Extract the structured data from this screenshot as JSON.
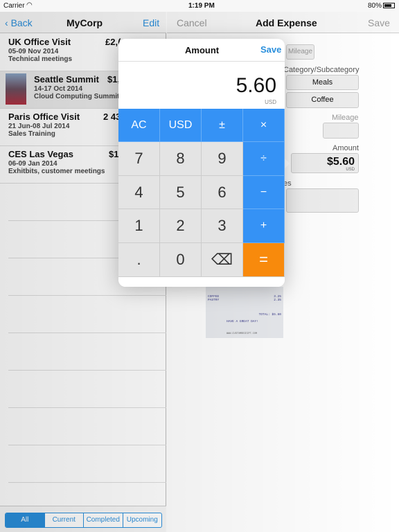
{
  "status": {
    "carrier": "Carrier",
    "time": "1:19 PM",
    "battery": "80%"
  },
  "left": {
    "back": "Back",
    "title": "MyCorp",
    "edit": "Edit",
    "trips": [
      {
        "title": "UK Office Visit",
        "dates": "05-09 Nov 2014",
        "desc": "Technical meetings",
        "amount": "£2,("
      },
      {
        "title": "Seattle Summit",
        "dates": "14-17 Oct 2014",
        "desc": "Cloud Computing Summit",
        "amount": "$1,"
      },
      {
        "title": "Paris Office Visit",
        "dates": "21 Jun-08 Jul 2014",
        "desc": "Sales Training",
        "amount": "2 43"
      },
      {
        "title": "CES Las Vegas",
        "dates": "06-09 Jan 2014",
        "desc": "Exhitbits, customer meetings",
        "amount": "$1"
      }
    ],
    "filters": [
      "All",
      "Current",
      "Completed",
      "Upcoming"
    ],
    "selected_filter": "All"
  },
  "right": {
    "cancel": "Cancel",
    "title": "Add Expense",
    "save": "Save",
    "mileage_button": "Mileage",
    "category_label": "Category/Subcategory",
    "category": "Meals",
    "subcategory": "Coffee",
    "mileage_label": "Mileage",
    "amount_label": "Amount",
    "amount": "$5.60",
    "amount_currency": "USD",
    "notes_label": "es",
    "receipt": {
      "lines": [
        [
          "COFFEE",
          "3.25"
        ],
        [
          "PASTRY",
          "2.35"
        ]
      ],
      "total": "TOTAL: $5.60",
      "footer": "HAVE A GREAT DAY!",
      "url": "WWW.CUSTOMRECEIPT.COM"
    }
  },
  "popover": {
    "title": "Amount",
    "save": "Save",
    "value": "5.60",
    "currency": "USD",
    "keys": [
      "AC",
      "USD",
      "±",
      "×",
      "7",
      "8",
      "9",
      "÷",
      "4",
      "5",
      "6",
      "−",
      "1",
      "2",
      "3",
      "+",
      ".",
      "0",
      "⌫",
      "="
    ]
  },
  "colors": {
    "accent": "#2a8fdc",
    "operator": "#3592f5",
    "equals": "#f88a0c"
  }
}
